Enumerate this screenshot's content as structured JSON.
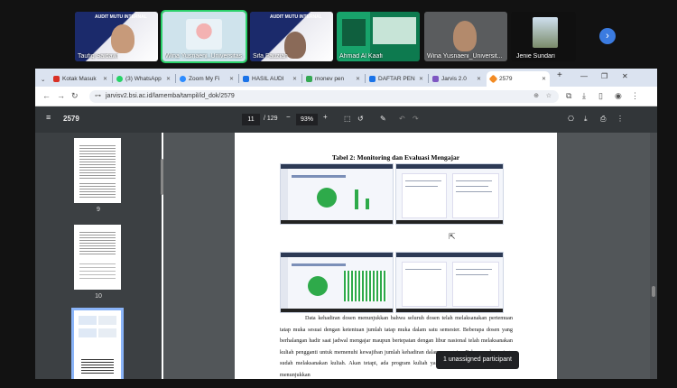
{
  "participants": [
    {
      "name": "Taufiq Saidawi",
      "kind": "slide",
      "slide_text": "AUDIT MUTU INTERNAL"
    },
    {
      "name": "Wina Yusnaeni_Universitas ...",
      "kind": "avatar",
      "active": true
    },
    {
      "name": "Sifa Fauziah",
      "kind": "slide",
      "slide_text": "AUDIT MUTU INTERNAL"
    },
    {
      "name": "Ahmad Al Kaafi",
      "kind": "banner"
    },
    {
      "name": "Wina Yusnaeni_Universit...",
      "kind": "camera"
    },
    {
      "name": "Jenie Sundari",
      "kind": "photo"
    }
  ],
  "next_icon": "chevron-right-icon",
  "tabs": [
    {
      "label": "Kotak Masuk",
      "color": "#d93025"
    },
    {
      "label": "(3) WhatsApp",
      "color": "#25d366"
    },
    {
      "label": "Zoom My Fi",
      "color": "#2d8cff"
    },
    {
      "label": "HASIL AUDI",
      "color": "#1a73e8"
    },
    {
      "label": "monev pen",
      "color": "#34a853"
    },
    {
      "label": "DAFTAR PEN",
      "color": "#1a73e8"
    },
    {
      "label": "Jarvis 2.0",
      "color": "#7e57c2"
    },
    {
      "label": "2579",
      "color": "#f28b24",
      "selected": true
    }
  ],
  "url": "jarvisv2.bsi.ac.id/lamemba/tampil/id_dok/2579",
  "pdf": {
    "title": "2579",
    "page_current": "11",
    "page_total": "/ 129",
    "zoom": "93%",
    "thumbnails": [
      "9",
      "10"
    ],
    "table_title": "Tabel 2: Monitoring dan Evaluasi Mengajar",
    "body_text": "Data kehadiran dosen menunjukkan bahwa seluruh dosen telah melaksanakan pertemuan tatap muka sesuai dengan ketentuan jumlah tatap muka dalam satu semester. Beberapa dosen yang berhalangan hadir saat jadwal mengajar maupun bertepatan dengan libur nasional telah melaksanakan kuliah pengganti untuk memenuhi kewajiban jumlah kehadiran dalam mengajar. Beberapa dosen juga sudah melaksanakan kuliah. Akan tetapi, ada program kuliah yang ada kendala dengan Tabel 2 menunjukkan"
  },
  "tooltip": "1 unassigned participant"
}
